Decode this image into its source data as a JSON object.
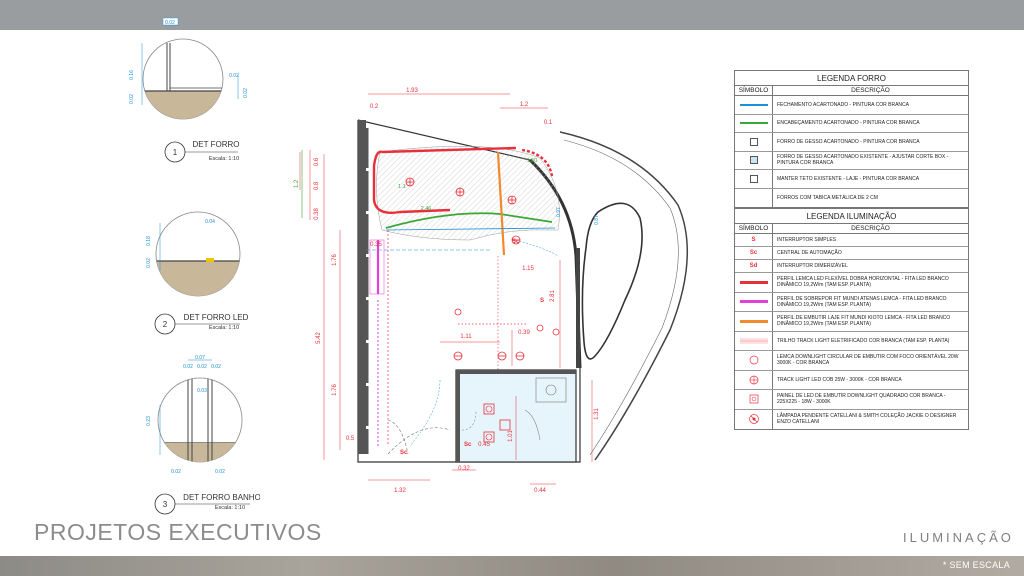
{
  "page": {
    "title": "PROJETOS EXECUTIVOS",
    "section": "ILUMINAÇÃO",
    "note": "* SEM ESCALA"
  },
  "details": [
    {
      "number": "1",
      "name": "DET FORRO",
      "scale": "Escala: 1:10",
      "dims": [
        "0.02",
        "0.16",
        "0.02",
        "0.02",
        "0.02"
      ]
    },
    {
      "number": "2",
      "name": "DET FORRO LED",
      "scale": "Escala: 1:10",
      "dims": [
        "0.04",
        "0.18",
        "0.02"
      ]
    },
    {
      "number": "3",
      "name": "DET FORRO BANHO",
      "scale": "Escala: 1:10",
      "dims": [
        "0.07",
        "0.02",
        "0.02",
        "0.02",
        "0.03",
        "0.23",
        "0.02",
        "0.02"
      ]
    }
  ],
  "plan": {
    "dims": {
      "d193": "1.93",
      "d12a": "1.2",
      "d02": "0.2",
      "d06": "0.6",
      "d08": "0.8",
      "d12b": "1.2",
      "d038": "0.38",
      "d176a": "1.76",
      "d542": "5.42",
      "d176b": "1.76",
      "d05": "0.5",
      "d132": "1.32",
      "d032": "0.32",
      "d044": "0.44",
      "d281": "2.81",
      "d111": "1.11",
      "d039": "0.39",
      "d101": "1.01",
      "d131": "1.31",
      "d115": "1.15",
      "d246": "2.46",
      "d11": "1.1",
      "d035": "0.35",
      "d150": "1.50",
      "d045": "0.45",
      "d097": "0.97",
      "d087": "0.87",
      "d01": "0.1"
    },
    "labels": {
      "sc1": "Sc",
      "sc2": "Sc",
      "sc3": "Sc",
      "s1": "S"
    }
  },
  "legend_forro": {
    "title": "LEGENDA FORRO",
    "col_symbol": "SÍMBOLO",
    "col_desc": "DESCRIÇÃO",
    "rows": [
      {
        "symbol": "line",
        "color": "#1e90d6",
        "desc": "FECHAMENTO ACARTONADO - PINTURA COR BRANCA"
      },
      {
        "symbol": "line",
        "color": "#3aa635",
        "desc": "ENCABEÇAMENTO ACARTONADO - PINTURA COR BRANCA"
      },
      {
        "symbol": "box",
        "desc": "FORRO DE GESSO ACARTONADO - PINTURA COR BRANCA"
      },
      {
        "symbol": "box-fill",
        "desc": "FORRO DE GESSO ACARTONADO EXISTENTE - AJUSTAR CORTE BOX - PINTURA COR BRANCA"
      },
      {
        "symbol": "box",
        "desc": "MANTER TETO EXISTENTE - LAJE - PINTURA COR BRANCA"
      },
      {
        "symbol": "none",
        "desc": "FORROS COM TABICA METÁLICA DE 2 CM"
      }
    ]
  },
  "legend_ilum": {
    "title": "LEGENDA ILUMINAÇÃO",
    "col_symbol": "SÍMBOLO",
    "col_desc": "DESCRIÇÃO",
    "rows": [
      {
        "symbol": "text",
        "text": "S",
        "desc": "INTERRUPTOR SIMPLES"
      },
      {
        "symbol": "text",
        "text": "Sc",
        "desc": "CENTRAL DE AUTOMAÇÃO"
      },
      {
        "symbol": "text",
        "text": "Sd",
        "desc": "INTERRUPTOR DIMERIZÁVEL"
      },
      {
        "symbol": "line",
        "color": "#e8303a",
        "desc": "PERFIL LEMCA LED FLEXÍVEL DOBRA HORIZONTAL - FITA LED BRANCO DINÂMICO 19,2W/m (TAM ESP. PLANTA)"
      },
      {
        "symbol": "line",
        "color": "#e040d8",
        "desc": "PERFIL DE SOBREPOR FIT MUNDI ATENAS LEMCA - FITA LED BRANCO DINÂMICO 19,2W/m (TAM ESP. PLANTA)"
      },
      {
        "symbol": "line",
        "color": "#f08a2c",
        "desc": "PERFIL DE EMBUTIR LAJE FIT MUNDI KIOTO LEMCA - FITA LED BRANCO DINÂMICO 19,2W/m (TAM ESP. PLANTA)"
      },
      {
        "symbol": "track",
        "desc": "TRILHO TRACK LIGHT ELETRIFICADO COR BRANCA (TAM ESP. PLANTA)"
      },
      {
        "symbol": "circle",
        "desc": "LEMCA DOWNLIGHT CIRCULAR DE EMBUTIR COM FOCO ORIENTÁVEL 20W 3000K - COR BRANCA"
      },
      {
        "symbol": "track-light",
        "desc": "TRACK LIGHT LED COB 25W - 3000K - COR BRANCA"
      },
      {
        "symbol": "panel",
        "desc": "PAINEL DE LED DE EMBUTIR DOWNLIGHT QUADRADO COR BRANCA - 225X225 - 18W - 3000K"
      },
      {
        "symbol": "pendant",
        "desc": "LÂMPADA PENDENTE CATELLANI & SMITH COLEÇÃO JACKIE O DESIGNER ENZO CATELLANI"
      }
    ]
  },
  "colors": {
    "red": "#e8303a",
    "green": "#3aa635",
    "blue": "#1e90d6",
    "magenta": "#e040d8",
    "orange": "#f08a2c",
    "header_band": "#9a9d9f"
  }
}
